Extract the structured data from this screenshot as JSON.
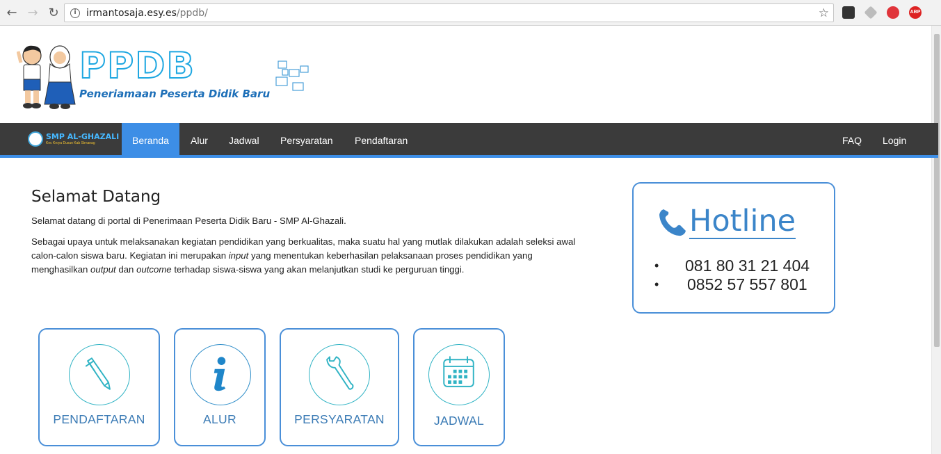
{
  "browser": {
    "url_host": "irmantosaja.esy.es",
    "url_path": "/ppdb/",
    "ext4_label": "ABP"
  },
  "header": {
    "title": "PPDB",
    "subtitle": "Peneriamaan Peserta Didik Baru"
  },
  "navbar": {
    "brand_name": "SMP AL-GHAZALI",
    "brand_tag": "Kec Kroya Dusun Kab Sirnanag",
    "items": [
      "Beranda",
      "Alur",
      "Jadwal",
      "Persyaratan",
      "Pendaftaran"
    ],
    "right_items": [
      "FAQ",
      "Login"
    ]
  },
  "welcome": {
    "title": "Selamat Datang",
    "para1": "Selamat datang di portal di Penerimaan Peserta Didik Baru - SMP Al-Ghazali.",
    "para2_a": "Sebagai upaya untuk melaksanakan kegiatan pendidikan yang berkualitas, maka suatu hal yang mutlak dilakukan adalah seleksi awal calon-calon siswa baru.  Kegiatan ini merupakan ",
    "para2_input": "input",
    "para2_b": " yang menentukan keberhasilan pelaksanaan proses pendidikan yang menghasilkan ",
    "para2_output": "output",
    "para2_c": " dan ",
    "para2_outcome": "outcome",
    "para2_d": " terhadap siswa-siswa yang akan melanjutkan studi ke perguruan tinggi."
  },
  "hotline": {
    "title": "Hotline",
    "numbers": [
      "081 80 31 21 404",
      "0852 57 557 801"
    ]
  },
  "cards": [
    {
      "label": "PENDAFTARAN",
      "icon": "pen-icon"
    },
    {
      "label": "ALUR",
      "icon": "info-icon"
    },
    {
      "label": "PERSYARATAN",
      "icon": "wrench-icon"
    },
    {
      "label": "JADWAL",
      "icon": "calendar-icon"
    }
  ],
  "colors": {
    "accent": "#3d8ee6",
    "navbar": "#3b3b3b",
    "teal": "#2fb3c4"
  }
}
